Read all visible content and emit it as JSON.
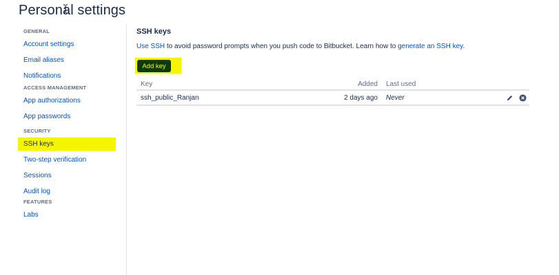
{
  "page": {
    "title": "Personal settings"
  },
  "sidebar": {
    "sections": [
      {
        "heading": "GENERAL",
        "items": [
          "Account settings",
          "Email aliases",
          "Notifications"
        ]
      },
      {
        "heading": "ACCESS MANAGEMENT",
        "items": [
          "App authorizations",
          "App passwords"
        ]
      },
      {
        "heading": "SECURITY",
        "items": [
          "SSH keys",
          "Two-step verification",
          "Sessions",
          "Audit log"
        ]
      },
      {
        "heading": "FEATURES",
        "items": [
          "Labs"
        ]
      }
    ],
    "active_item": "SSH keys"
  },
  "main": {
    "title": "SSH keys",
    "intro": {
      "link1": "Use SSH",
      "text1": " to avoid password prompts when you push code to Bitbucket. Learn how to ",
      "link2": "generate an SSH key",
      "text2": "."
    },
    "add_key_label": "Add key",
    "table": {
      "headers": {
        "key": "Key",
        "added": "Added",
        "last_used": "Last used"
      },
      "rows": [
        {
          "key": "ssh_public_Ranjan",
          "added": "2 days ago",
          "last_used": "Never"
        }
      ]
    }
  },
  "colors": {
    "link": "#0052cc",
    "highlight": "#f5f500",
    "button_bg": "#0b3b0b",
    "text": "#172b4d",
    "muted": "#5e6c84"
  },
  "icons": {
    "edit": "pencil-icon",
    "delete": "close-circle-icon",
    "cursor": "text-cursor-icon"
  }
}
